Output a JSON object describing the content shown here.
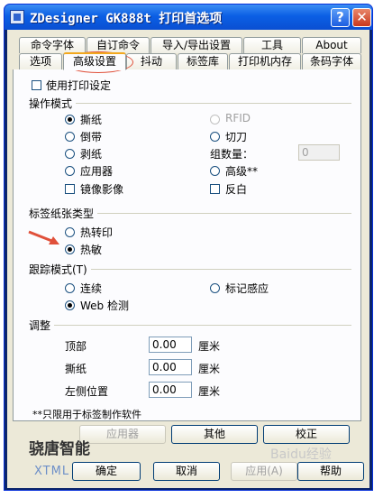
{
  "window": {
    "title": "ZDesigner GK888t 打印首选项",
    "help_glyph": "?",
    "close_glyph": "✕"
  },
  "tabs_back": [
    "命令字体",
    "自订命令",
    "导入/导出设置",
    "工具",
    "About"
  ],
  "tabs_front": [
    "选项",
    "高级设置",
    "抖动",
    "标签库",
    "打印机内存",
    "条码字体"
  ],
  "use_printer_settings": {
    "label": "使用打印设定",
    "checked": false
  },
  "operation_mode": {
    "heading": "操作模式",
    "left": [
      {
        "label": "撕纸",
        "selected": true
      },
      {
        "label": "倒带",
        "selected": false
      },
      {
        "label": "剥纸",
        "selected": false
      },
      {
        "label": "应用器",
        "selected": false
      }
    ],
    "right": [
      {
        "label": "RFID",
        "selected": false,
        "disabled": true
      },
      {
        "label": "切刀",
        "selected": false
      }
    ],
    "group_count_label": "组数量：",
    "group_count_value": "0",
    "advanced_label": "高级**",
    "mirror_label": "镜像影像",
    "reverse_label": "反白"
  },
  "label_type": {
    "heading": "标签纸张类型",
    "options": [
      {
        "label": "热转印",
        "selected": false
      },
      {
        "label": "热敏",
        "selected": true
      }
    ]
  },
  "tracking_mode": {
    "heading": "跟踪模式(T)",
    "options": [
      {
        "label": "连续",
        "selected": false
      },
      {
        "label": "标记感应",
        "selected": false
      },
      {
        "label": "Web 检测",
        "selected": true
      }
    ]
  },
  "adjust": {
    "heading": "调整",
    "rows": [
      {
        "label": "顶部",
        "value": "0.00",
        "unit": "厘米"
      },
      {
        "label": "撕纸",
        "value": "0.00",
        "unit": "厘米"
      },
      {
        "label": "左侧位置",
        "value": "0.00",
        "unit": "厘米"
      }
    ]
  },
  "note": "**只限用于标签制作软件",
  "panel_buttons": [
    "应用器",
    "其他",
    "校正"
  ],
  "dialog_buttons": [
    "确定",
    "取消",
    "应用(A)",
    "帮助"
  ],
  "watermark": {
    "brand": "骁唐智能",
    "logo": "XTML",
    "site": "Baidu经验"
  },
  "colors": {
    "title_bar": "#0b5fe5",
    "dialog": "#ece9d8",
    "active_tab_accent": "#f2a81e",
    "annotation": "#e0503a"
  }
}
